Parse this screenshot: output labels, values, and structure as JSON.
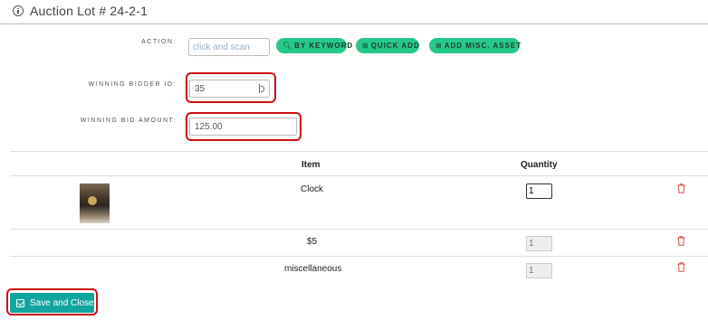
{
  "header": {
    "title": "Auction Lot # 24-2-1",
    "icon": "info-circle-icon"
  },
  "form": {
    "action_label": "ACTION:",
    "scan_placeholder": "click and scan",
    "buttons": {
      "by_keyword": "BY KEYWORD",
      "quick_add": "QUICK ADD",
      "add_misc_asset": "ADD MISC. ASSET"
    },
    "winning_bidder_label": "WINNING BIDDER ID:",
    "winning_bidder_value": "35",
    "winning_bid_label": "WINNING BID AMOUNT:",
    "winning_bid_value": "125.00"
  },
  "table": {
    "headers": {
      "item": "Item",
      "quantity": "Quantity"
    },
    "rows": [
      {
        "item": "Clock",
        "quantity": "1",
        "has_image": true,
        "editable": true
      },
      {
        "item": "$5",
        "quantity": "1",
        "has_image": false,
        "editable": false
      },
      {
        "item": "miscellaneous",
        "quantity": "1",
        "has_image": false,
        "editable": false
      }
    ]
  },
  "footer": {
    "save_label": "Save and Close"
  },
  "colors": {
    "accent_green": "#27c98a",
    "teal_button": "#12a5a0",
    "highlight_red": "#cc1010",
    "trash_red": "#e04545"
  }
}
